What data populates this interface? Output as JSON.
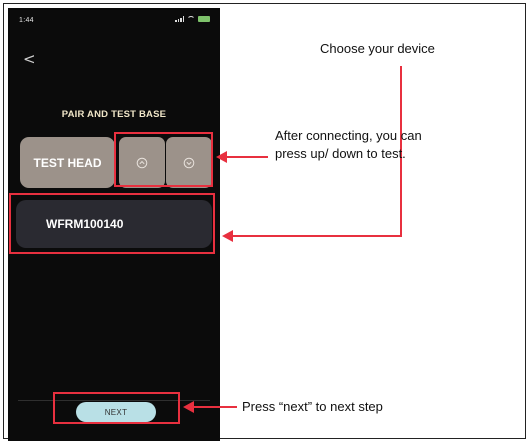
{
  "phone": {
    "status_time": "1:44",
    "back_label": "<",
    "screen_title": "PAIR AND TEST BASE",
    "test_head_label": "TEST HEAD",
    "up_icon": "chevron-up-icon",
    "down_icon": "chevron-down-icon",
    "device_name": "WFRM100140",
    "next_label": "NEXT"
  },
  "annotations": {
    "choose_device": "Choose your device",
    "updown_line1": "After connecting, you can",
    "updown_line2": "press up/ down to test.",
    "next_step": "Press “next” to next step"
  },
  "colors": {
    "highlight": "#e8303f",
    "button_gray": "#9c928a",
    "device_card": "#2a2a31",
    "next_button": "#b9e0e6",
    "title_text": "#f0e6c8"
  }
}
